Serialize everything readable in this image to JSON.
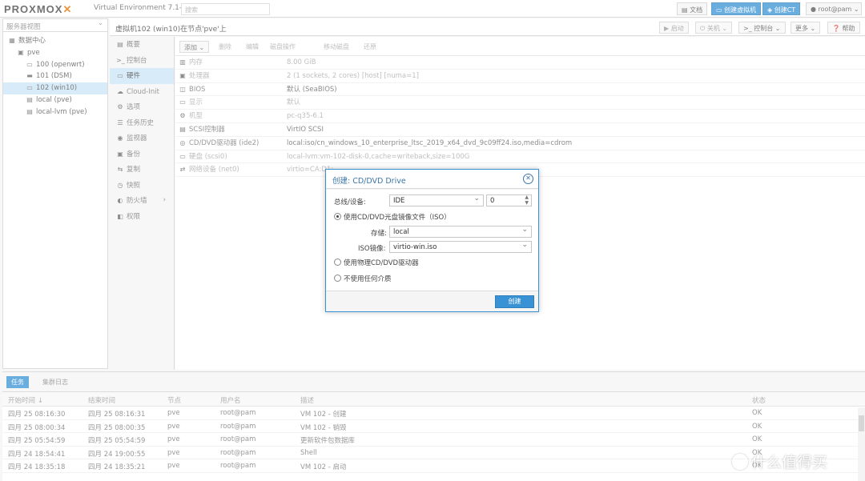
{
  "topbar": {
    "logo_text": "PROXMOX",
    "product": "Virtual Environment 7.1-7",
    "search_placeholder": "搜索",
    "docs_label": "文档",
    "create_vm_label": "创建虚拟机",
    "create_ct_label": "创建CT",
    "user_label": "root@pam"
  },
  "sidebar": {
    "view_label": "服务器视图",
    "tree": [
      {
        "label": "数据中心",
        "icon": "datacenter-icon",
        "indent": 0
      },
      {
        "label": "pve",
        "icon": "node-icon",
        "indent": 1
      },
      {
        "label": "100 (openwrt)",
        "icon": "vm-icon",
        "indent": 2
      },
      {
        "label": "101 (DSM)",
        "icon": "vm-running-icon",
        "indent": 2
      },
      {
        "label": "102 (win10)",
        "icon": "vm-icon",
        "indent": 2,
        "selected": true
      },
      {
        "label": "local (pve)",
        "icon": "storage-icon",
        "indent": 2
      },
      {
        "label": "local-lvm (pve)",
        "icon": "storage-icon",
        "indent": 2
      }
    ]
  },
  "header": {
    "breadcrumb": "虚拟机102 (win10)在节点'pve'上",
    "start_label": "启动",
    "shutdown_label": "关机",
    "console_label": "控制台",
    "more_label": "更多",
    "help_label": "帮助"
  },
  "vm_menu": [
    {
      "label": "概要",
      "icon": "summary-icon"
    },
    {
      "label": "控制台",
      "icon": "console-icon"
    },
    {
      "label": "硬件",
      "icon": "hardware-icon",
      "selected": true
    },
    {
      "label": "Cloud-Init",
      "icon": "cloud-icon"
    },
    {
      "label": "选项",
      "icon": "options-icon"
    },
    {
      "label": "任务历史",
      "icon": "task-history-icon"
    },
    {
      "label": "监视器",
      "icon": "monitor-icon"
    },
    {
      "label": "备份",
      "icon": "backup-icon"
    },
    {
      "label": "复制",
      "icon": "replication-icon"
    },
    {
      "label": "快照",
      "icon": "snapshot-icon"
    },
    {
      "label": "防火墙",
      "icon": "firewall-icon",
      "has_submenu": true
    },
    {
      "label": "权限",
      "icon": "permissions-icon"
    }
  ],
  "hardware_toolbar": [
    "添加",
    "删除",
    "编辑",
    "磁盘操作",
    "移动磁盘",
    "还原"
  ],
  "hardware": [
    {
      "key": "内存",
      "value": "8.00 GiB",
      "icon": "memory-icon",
      "faded": true
    },
    {
      "key": "处理器",
      "value": "2 (1 sockets, 2 cores) [host] [numa=1]",
      "icon": "cpu-icon",
      "faded": true
    },
    {
      "key": "BIOS",
      "value": "默认 (SeaBIOS)",
      "icon": "bios-icon",
      "faded": false
    },
    {
      "key": "显示",
      "value": "默认",
      "icon": "display-icon",
      "faded": true
    },
    {
      "key": "机型",
      "value": "pc-q35-6.1",
      "icon": "machine-icon",
      "faded": true
    },
    {
      "key": "SCSI控制器",
      "value": "VirtIO SCSI",
      "icon": "controller-icon",
      "faded": false
    },
    {
      "key": "CD/DVD驱动器 (ide2)",
      "value": "local:iso/cn_windows_10_enterprise_ltsc_2019_x64_dvd_9c09ff24.iso,media=cdrom",
      "icon": "cdrom-icon",
      "faded": false
    },
    {
      "key": "硬盘 (scsi0)",
      "value": "local-lvm:vm-102-disk-0,cache=writeback,size=100G",
      "icon": "harddisk-icon",
      "faded": true
    },
    {
      "key": "网络设备 (net0)",
      "value": "virtio=CA:D1:",
      "icon": "network-icon",
      "faded": true
    }
  ],
  "dialog": {
    "title": "创建: CD/DVD Drive",
    "bus_label": "总线/设备:",
    "bus_value": "IDE",
    "device_value": "0",
    "radio_iso_label": "使用CD/DVD光盘镜像文件（ISO）",
    "storage_label": "存储:",
    "storage_value": "local",
    "iso_label": "ISO镜像:",
    "iso_value": "virtio-win.iso",
    "radio_physical_label": "使用物理CD/DVD驱动器",
    "radio_none_label": "不使用任何介质",
    "create_label": "创建"
  },
  "bottom": {
    "tab_tasks": "任务",
    "tab_cluster_log": "集群日志",
    "columns": [
      "开始时间 ↓",
      "结束时间",
      "节点",
      "用户名",
      "描述",
      "状态"
    ],
    "rows": [
      [
        "四月 25 08:16:30",
        "四月 25 08:16:31",
        "pve",
        "root@pam",
        "VM 102 - 创建",
        "OK"
      ],
      [
        "四月 25 08:00:34",
        "四月 25 08:00:35",
        "pve",
        "root@pam",
        "VM 102 - 销毁",
        "OK"
      ],
      [
        "四月 25 05:54:59",
        "四月 25 05:54:59",
        "pve",
        "root@pam",
        "更新软件包数据库",
        "OK"
      ],
      [
        "四月 24 18:54:41",
        "四月 24 19:00:55",
        "pve",
        "root@pam",
        "Shell",
        "OK"
      ],
      [
        "四月 24 18:35:18",
        "四月 24 18:35:21",
        "pve",
        "root@pam",
        "VM 102 - 启动",
        "OK"
      ]
    ]
  },
  "watermark": "什么值得买"
}
